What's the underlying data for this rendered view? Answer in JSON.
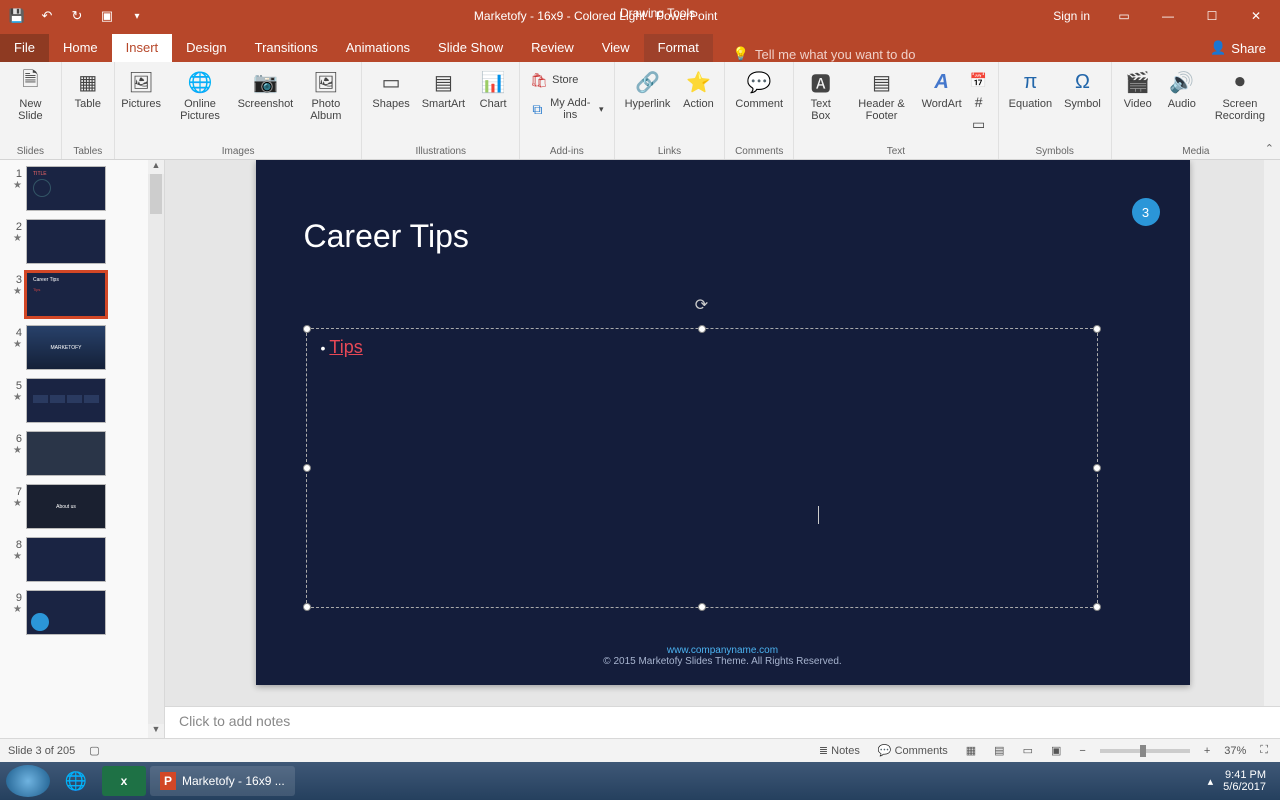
{
  "titlebar": {
    "title": "Marketofy - 16x9 - Colored Light  -  PowerPoint",
    "drawing_tools": "Drawing Tools",
    "sign_in": "Sign in"
  },
  "menu": {
    "file": "File",
    "home": "Home",
    "insert": "Insert",
    "design": "Design",
    "transitions": "Transitions",
    "animations": "Animations",
    "slideshow": "Slide Show",
    "review": "Review",
    "view": "View",
    "format": "Format",
    "tellme": "Tell me what you want to do",
    "share": "Share"
  },
  "ribbon": {
    "slides": {
      "new_slide": "New\nSlide",
      "group": "Slides"
    },
    "tables": {
      "table": "Table",
      "group": "Tables"
    },
    "images": {
      "pictures": "Pictures",
      "online": "Online\nPictures",
      "screenshot": "Screenshot",
      "album": "Photo\nAlbum",
      "group": "Images"
    },
    "illus": {
      "shapes": "Shapes",
      "smartart": "SmartArt",
      "chart": "Chart",
      "group": "Illustrations"
    },
    "addins": {
      "store": "Store",
      "myaddins": "My Add-ins",
      "group": "Add-ins"
    },
    "links": {
      "hyperlink": "Hyperlink",
      "action": "Action",
      "group": "Links"
    },
    "comments": {
      "comment": "Comment",
      "group": "Comments"
    },
    "text": {
      "textbox": "Text\nBox",
      "header": "Header\n& Footer",
      "wordart": "WordArt",
      "group": "Text"
    },
    "symbols": {
      "eq": "Equation",
      "sym": "Symbol",
      "group": "Symbols"
    },
    "media": {
      "video": "Video",
      "audio": "Audio",
      "rec": "Screen\nRecording",
      "group": "Media"
    }
  },
  "thumbs": {
    "selected": 3,
    "items": [
      {
        "n": "1"
      },
      {
        "n": "2"
      },
      {
        "n": "3"
      },
      {
        "n": "4"
      },
      {
        "n": "5"
      },
      {
        "n": "6"
      },
      {
        "n": "7"
      },
      {
        "n": "8"
      },
      {
        "n": "9"
      }
    ]
  },
  "slide": {
    "heading": "Career Tips",
    "badge": "3",
    "bullet1": "Tips",
    "footer_link": "www.companyname.com",
    "footer_copy": "© 2015 Marketofy Slides Theme. All Rights Reserved."
  },
  "notes_placeholder": "Click to add notes",
  "status": {
    "slide_of": "Slide 3 of 205",
    "notes": "Notes",
    "comments": "Comments",
    "zoom": "37%"
  },
  "taskbar": {
    "powerpoint_title": "Marketofy - 16x9 ...",
    "time": "9:41 PM",
    "date": "5/6/2017"
  }
}
